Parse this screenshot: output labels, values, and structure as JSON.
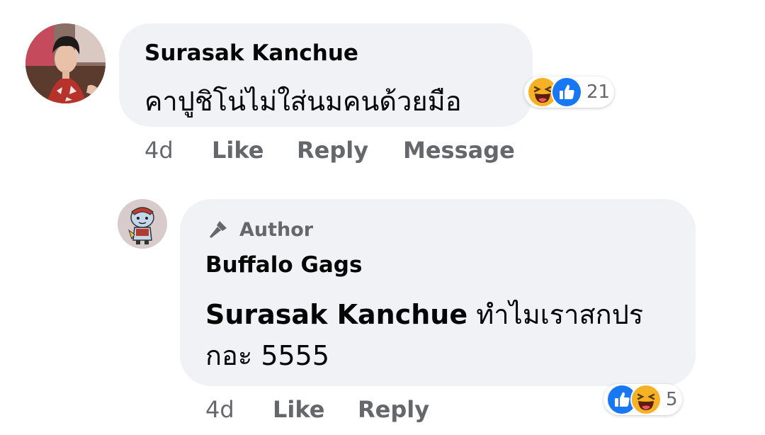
{
  "comment": {
    "author_name": "Surasak Kanchue",
    "text": "คาปูชิโน่ไม่ใส่นมคนด้วยมือ",
    "reaction_icons": [
      "haha-icon",
      "like-icon"
    ],
    "reaction_count": "21",
    "time": "4d",
    "actions": {
      "like": "Like",
      "reply": "Reply",
      "message": "Message"
    }
  },
  "reply": {
    "badge": "Author",
    "author_name": "Buffalo Gags",
    "mention": "Surasak Kanchue",
    "text_line1": " ทำไมเราสกปร",
    "text_line2": "กอะ 5555",
    "reaction_icons": [
      "like-icon",
      "haha-icon"
    ],
    "reaction_count": "5",
    "time": "4d",
    "actions": {
      "like": "Like",
      "reply": "Reply"
    }
  },
  "colors": {
    "bubble": "#f0f2f5",
    "meta_text": "#65676b",
    "like_blue": "#1877f2",
    "haha_yellow": "#f7b125"
  }
}
